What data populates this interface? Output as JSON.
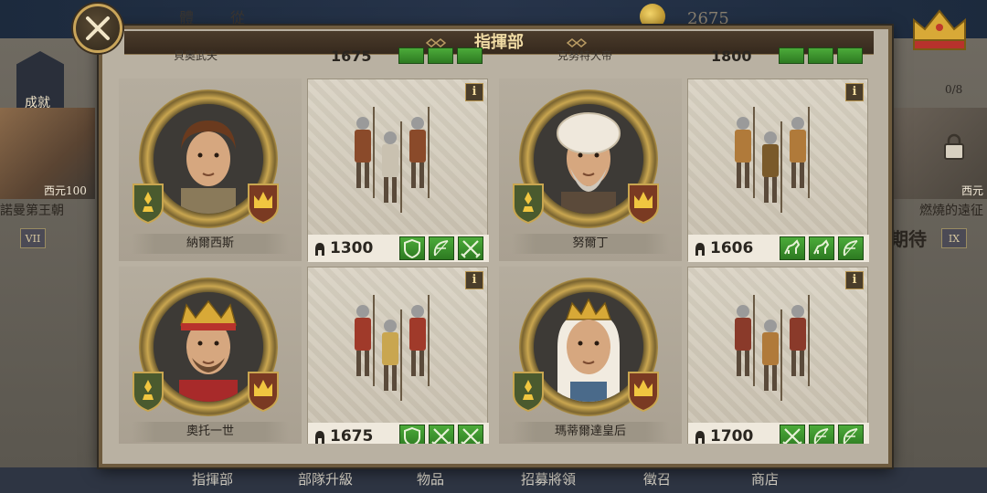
{
  "background": {
    "top_label_left": "體",
    "top_label_right": "從",
    "gold_amount": "2675",
    "achievements_label": "成就",
    "left_era": {
      "year": "西元100",
      "title": "諾曼第王朝",
      "roman": "VII"
    },
    "right_era": {
      "count": "0/8",
      "year": "西元",
      "title": "燃燒的遠征",
      "soon": "期待",
      "roman": "IX"
    },
    "bottom_tabs": [
      "指揮部",
      "部隊升級",
      "物品",
      "招募將領",
      "徵召",
      "商店"
    ]
  },
  "modal": {
    "title": "指揮部",
    "close_icon": "close-x-icon",
    "top_partial": [
      {
        "name": "貝奧武夫",
        "power": "1675"
      },
      {
        "name": "克努特大帝",
        "power": "1800"
      }
    ],
    "commanders": [
      {
        "name": "納爾西斯",
        "power": "1300",
        "skills": [
          "shield-skill",
          "bow-skill",
          "crossed-swords-skill"
        ],
        "portrait": "young-noble"
      },
      {
        "name": "努爾丁",
        "power": "1606",
        "skills": [
          "cavalry-skill",
          "cavalry-skill",
          "bow-skill"
        ],
        "portrait": "turban-elder"
      },
      {
        "name": "奧托一世",
        "power": "1675",
        "skills": [
          "shield-skill",
          "crossed-swords-skill",
          "crossed-swords-skill"
        ],
        "portrait": "crowned-king"
      },
      {
        "name": "瑪蒂爾達皇后",
        "power": "1700",
        "skills": [
          "crossed-swords-skill",
          "bow-skill",
          "bow-skill"
        ],
        "portrait": "crowned-queen"
      }
    ],
    "info_label": "i"
  },
  "colors": {
    "skill_green": "#3b9a2d",
    "frame_gold": "#c9a650",
    "header_brown": "#3d2f22",
    "title_gold": "#f0dba4"
  }
}
